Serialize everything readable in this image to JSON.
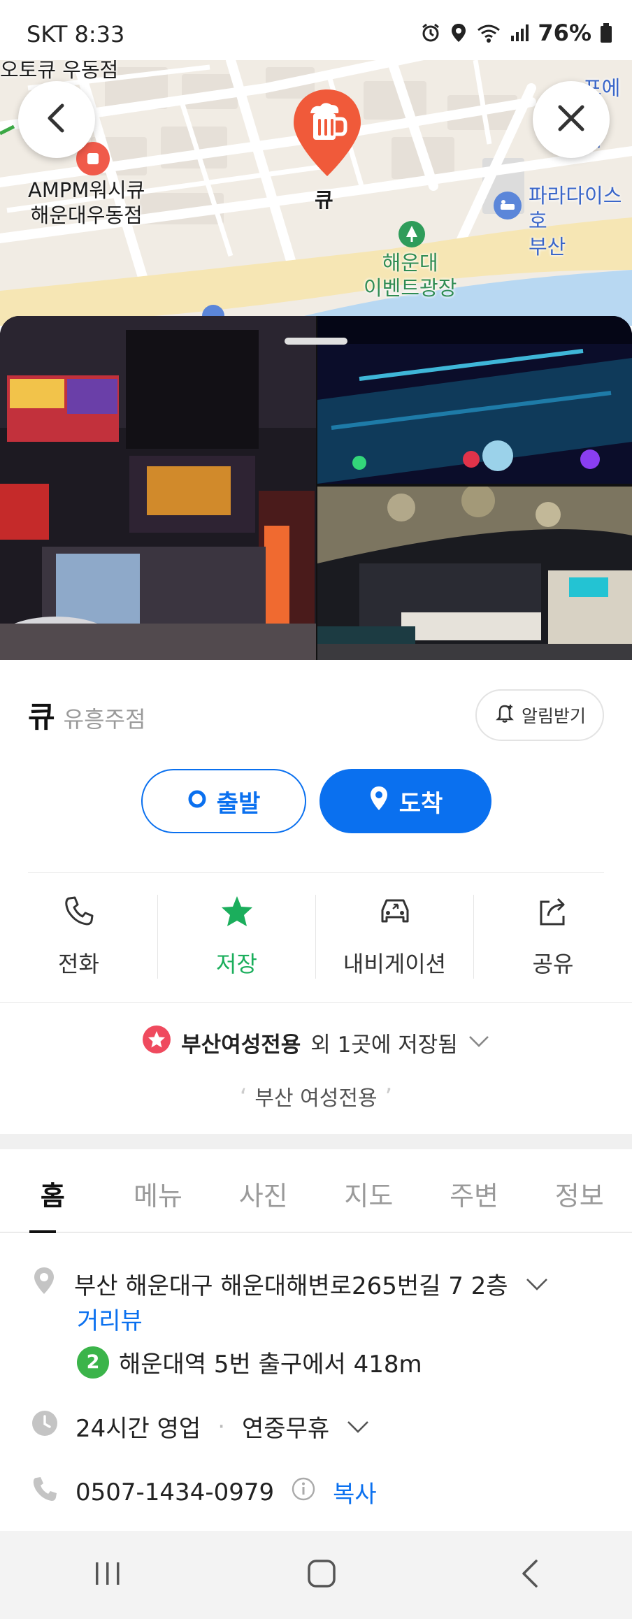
{
  "status_bar": {
    "carrier_time": "SKT 8:33",
    "battery": "76%"
  },
  "map": {
    "labels": {
      "top_left_place": "오토큐 우동점",
      "ampm": "AMPM워시큐\n해운대우동점",
      "selected_place": "큐",
      "event_square": "해운대\n이벤트광장",
      "paradise": "파라다이스호\n부산",
      "top_right_cut": "포에이\n해"
    }
  },
  "place": {
    "name": "큐",
    "category": "유흥주점",
    "alert_label": "알림받기"
  },
  "route": {
    "start_label": "출발",
    "arrive_label": "도착"
  },
  "actions": [
    {
      "label": "전화",
      "icon": "phone-icon"
    },
    {
      "label": "저장",
      "icon": "star-icon"
    },
    {
      "label": "내비게이션",
      "icon": "car-navigation-icon"
    },
    {
      "label": "공유",
      "icon": "share-icon"
    }
  ],
  "saved": {
    "list_name": "부산여성전용",
    "suffix": "외 1곳에 저장됨",
    "memo": "부산 여성전용"
  },
  "tabs": [
    "홈",
    "메뉴",
    "사진",
    "지도",
    "주변",
    "정보"
  ],
  "info": {
    "address": "부산 해운대구 해운대해변로265번길 7 2층",
    "street_view": "거리뷰",
    "subway_line": "2",
    "subway_directions": "해운대역 5번 출구에서 418m",
    "hours": "24시간 영업",
    "holiday": "연중무휴",
    "phone": "0507-1434-0979",
    "copy_label": "복사"
  },
  "colors": {
    "accent_blue": "#0a70ef",
    "save_green": "#1bae5c",
    "marker_orange": "#f05a3a",
    "subway_green": "#3bb44a"
  }
}
